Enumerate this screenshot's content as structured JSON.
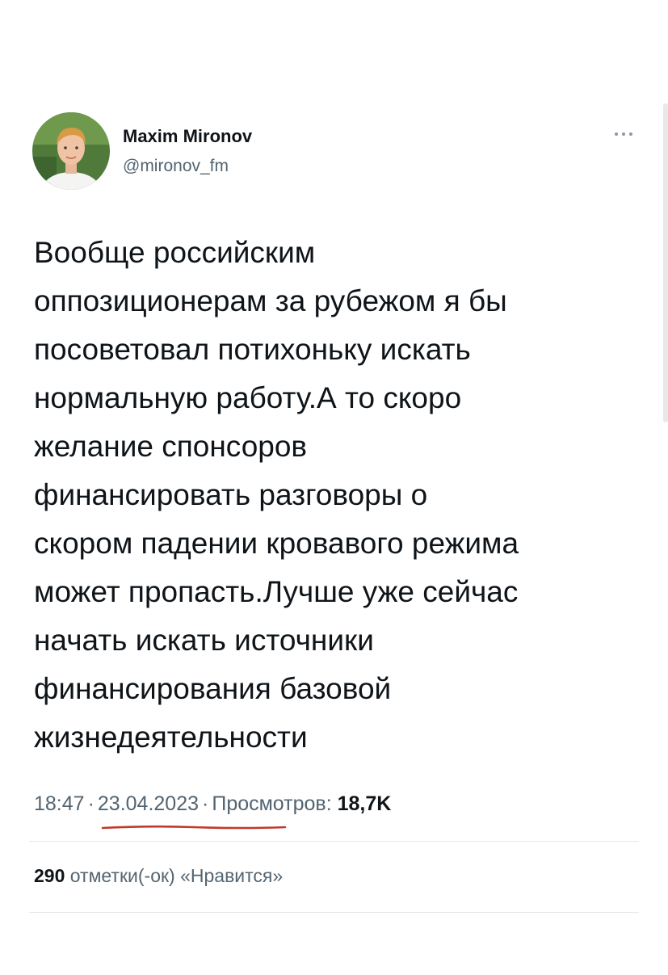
{
  "author": {
    "display_name": "Maxim Mironov",
    "handle": "@mironov_fm"
  },
  "tweet": {
    "text_lines": [
      "Вообще российским",
      "оппозиционерам за рубежом я бы",
      "посоветовал потихоньку искать",
      "нормальную работу.А то скоро",
      "желание спонсоров",
      "финансировать разговоры о",
      "скором падении кровавого режима",
      "может пропасть.Лучше уже сейчас",
      "начать искать источники",
      "финансирования базовой",
      "жизнедеятельности"
    ],
    "time": "18:47",
    "date": "23.04.2023",
    "views_label": "Просмотров:",
    "views_count": "18,7K",
    "separator": "·"
  },
  "engagement": {
    "likes_count": "290",
    "likes_label": "отметки(-ок) «Нравится»"
  },
  "icons": {
    "more": "more-horizontal-icon"
  },
  "colors": {
    "text_primary": "#0f1419",
    "text_secondary": "#536471",
    "underline_annotation": "#c0392b"
  }
}
